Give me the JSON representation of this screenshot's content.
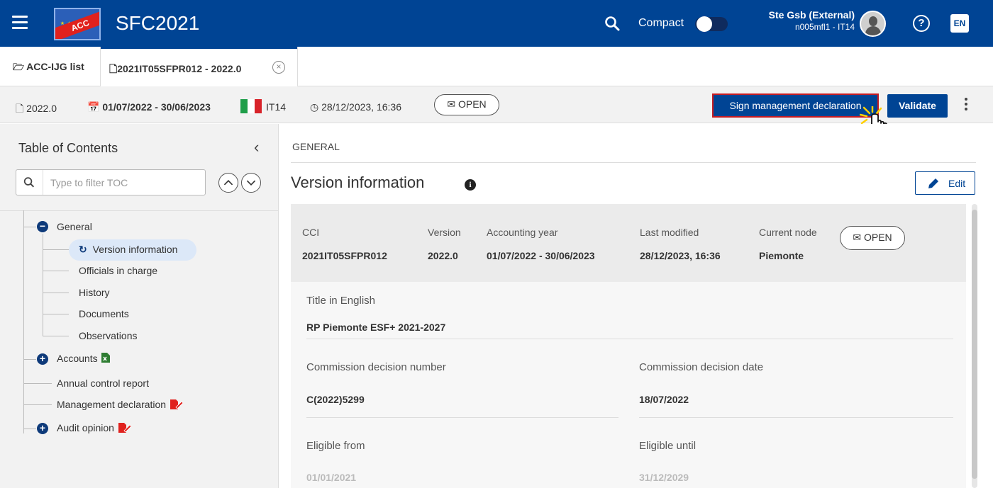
{
  "header": {
    "app_title": "SFC2021",
    "logo_text": "ACC",
    "compact_label": "Compact",
    "user_name": "Ste Gsb (External)",
    "user_code": "n005mfl1 - IT14",
    "help_symbol": "?",
    "language": "EN"
  },
  "tabs": [
    {
      "label": "ACC-IJG list",
      "icon": "folder-open-icon"
    },
    {
      "label": "2021IT05SFPR012 - 2022.0",
      "icon": "file-icon",
      "close_symbol": "×"
    }
  ],
  "infobar": {
    "version": "2022.0",
    "period": "01/07/2022 - 30/06/2023",
    "country": "IT14",
    "timestamp": "28/12/2023, 16:36",
    "status": "OPEN",
    "sign_button": "Sign management declaration",
    "validate_button": "Validate"
  },
  "toc": {
    "title": "Table of Contents",
    "collapse_symbol": "‹",
    "filter_placeholder": "Type to filter TOC",
    "items": [
      {
        "label": "General",
        "expander": "−"
      },
      {
        "label": "Version information"
      },
      {
        "label": "Officials in charge"
      },
      {
        "label": "History"
      },
      {
        "label": "Documents"
      },
      {
        "label": "Observations"
      },
      {
        "label": "Accounts",
        "expander": "+"
      },
      {
        "label": "Annual control report"
      },
      {
        "label": "Management declaration"
      },
      {
        "label": "Audit opinion",
        "expander": "+"
      }
    ]
  },
  "main": {
    "breadcrumb": "GENERAL",
    "title": "Version information",
    "info_symbol": "i",
    "edit_button": "Edit",
    "summary": {
      "cci_label": "CCI",
      "cci_value": "2021IT05SFPR012",
      "version_label": "Version",
      "version_value": "2022.0",
      "year_label": "Accounting year",
      "year_value": "01/07/2022 - 30/06/2023",
      "modified_label": "Last modified",
      "modified_value": "28/12/2023, 16:36",
      "node_label": "Current node",
      "node_value": "Piemonte",
      "status": "OPEN"
    },
    "fields": {
      "title_en_label": "Title in English",
      "title_en_value": "RP Piemonte ESF+ 2021-2027",
      "decision_number_label": "Commission decision number",
      "decision_number_value": "C(2022)5299",
      "decision_date_label": "Commission decision date",
      "decision_date_value": "18/07/2022",
      "eligible_from_label": "Eligible from",
      "eligible_from_value": "01/01/2021",
      "eligible_until_label": "Eligible until",
      "eligible_until_value": "31/12/2029"
    }
  },
  "colors": {
    "brand_blue": "#004494",
    "highlight_red": "#c51c22",
    "accounts_badge": "#2e7d32",
    "sign_badge": "#e0211d"
  }
}
